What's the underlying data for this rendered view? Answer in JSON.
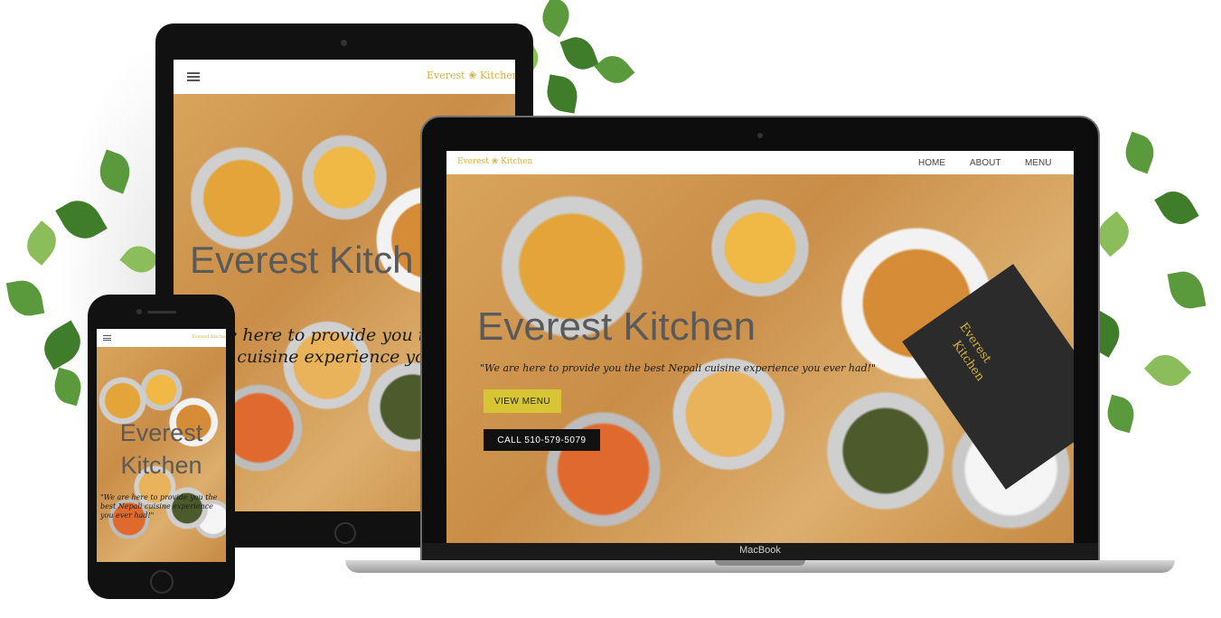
{
  "brand": {
    "logo_text": "Everest",
    "logo_text2": "Kitchen",
    "logo_color": "#d6b13a"
  },
  "desktop": {
    "nav": [
      "HOME",
      "ABOUT",
      "MENU"
    ],
    "hero_title": "Everest Kitchen",
    "tagline": "\"We are here to provide you the best Nepali cuisine experience you ever had!\"",
    "view_menu": "VIEW MENU",
    "call": "CALL 510-579-5079",
    "laptop_label": "MacBook",
    "menu_card_line1": "Everest",
    "menu_card_line2": "Kitchen"
  },
  "tablet": {
    "hero_title": "Everest Kitch",
    "tagline_line1": "re here to provide you th",
    "tagline_line2": "li cuisine experience you e"
  },
  "phone": {
    "hero_title_line1": "Everest",
    "hero_title_line2": "Kitchen",
    "tagline": "\"We are here to provide you the best Nepali cuisine experience you ever had!\""
  },
  "colors": {
    "button_yellow": "#d8c536",
    "button_black": "#111111",
    "plant_green": "#5b9a3c"
  }
}
